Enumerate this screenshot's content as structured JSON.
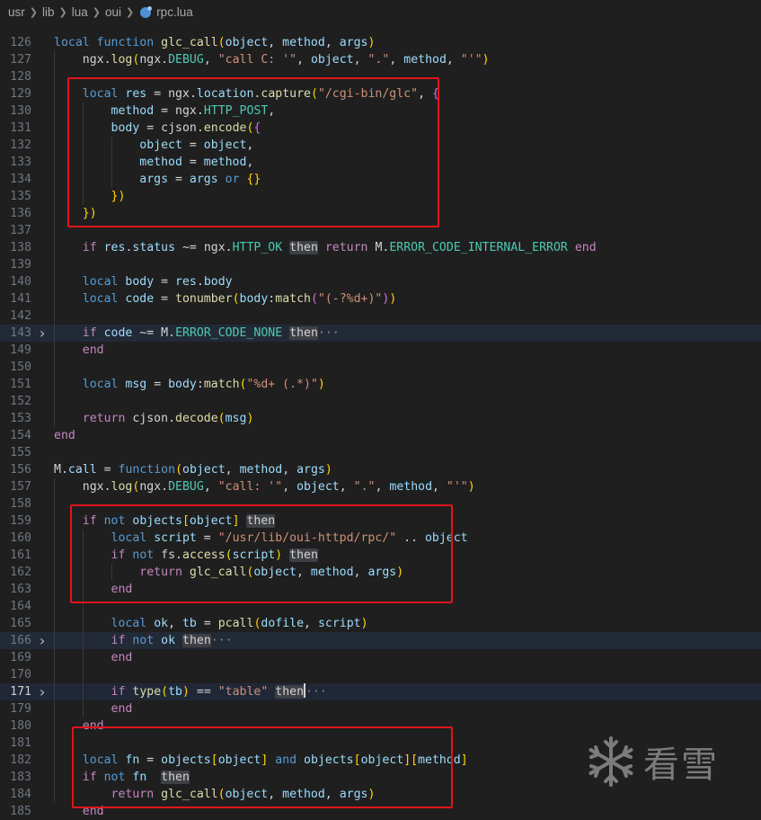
{
  "breadcrumb": {
    "segments": [
      "usr",
      "lib",
      "lua",
      "oui"
    ],
    "file": "rpc.lua",
    "file_icon": "lua-file-icon"
  },
  "editor": {
    "active_line": "171",
    "lines": [
      {
        "no": "126",
        "code": "local function glc_call(object, method, args)"
      },
      {
        "no": "127",
        "code": "    ngx.log(ngx.DEBUG, \"call C: '\", object, \".\", method, \"'\")"
      },
      {
        "no": "128",
        "code": ""
      },
      {
        "no": "129",
        "code": "    local res = ngx.location.capture(\"/cgi-bin/glc\", {"
      },
      {
        "no": "130",
        "code": "        method = ngx.HTTP_POST,"
      },
      {
        "no": "131",
        "code": "        body = cjson.encode({"
      },
      {
        "no": "132",
        "code": "            object = object,"
      },
      {
        "no": "133",
        "code": "            method = method,"
      },
      {
        "no": "134",
        "code": "            args = args or {}"
      },
      {
        "no": "135",
        "code": "        })"
      },
      {
        "no": "136",
        "code": "    })"
      },
      {
        "no": "137",
        "code": ""
      },
      {
        "no": "138",
        "code": "    if res.status ~= ngx.HTTP_OK then return M.ERROR_CODE_INTERNAL_ERROR end"
      },
      {
        "no": "139",
        "code": ""
      },
      {
        "no": "140",
        "code": "    local body = res.body"
      },
      {
        "no": "141",
        "code": "    local code = tonumber(body:match(\"(-?%d+)\"))"
      },
      {
        "no": "142",
        "code": ""
      },
      {
        "no": "143",
        "code": "    if code ~= M.ERROR_CODE_NONE then···",
        "folded": true
      },
      {
        "no": "149",
        "code": "    end"
      },
      {
        "no": "150",
        "code": ""
      },
      {
        "no": "151",
        "code": "    local msg = body:match(\"%d+ (.*)\")"
      },
      {
        "no": "152",
        "code": ""
      },
      {
        "no": "153",
        "code": "    return cjson.decode(msg)"
      },
      {
        "no": "154",
        "code": "end"
      },
      {
        "no": "155",
        "code": ""
      },
      {
        "no": "156",
        "code": "M.call = function(object, method, args)"
      },
      {
        "no": "157",
        "code": "    ngx.log(ngx.DEBUG, \"call: '\", object, \".\", method, \"'\")"
      },
      {
        "no": "158",
        "code": ""
      },
      {
        "no": "159",
        "code": "    if not objects[object] then"
      },
      {
        "no": "160",
        "code": "        local script = \"/usr/lib/oui-httpd/rpc/\" .. object"
      },
      {
        "no": "161",
        "code": "        if not fs.access(script) then"
      },
      {
        "no": "162",
        "code": "            return glc_call(object, method, args)"
      },
      {
        "no": "163",
        "code": "        end"
      },
      {
        "no": "164",
        "code": ""
      },
      {
        "no": "165",
        "code": "        local ok, tb = pcall(dofile, script)"
      },
      {
        "no": "166",
        "code": "        if not ok then···",
        "folded": true
      },
      {
        "no": "169",
        "code": "        end"
      },
      {
        "no": "170",
        "code": ""
      },
      {
        "no": "171",
        "code": "        if type(tb) == \"table\" then···",
        "folded": true,
        "current": true
      },
      {
        "no": "179",
        "code": "        end"
      },
      {
        "no": "180",
        "code": "    end"
      },
      {
        "no": "181",
        "code": ""
      },
      {
        "no": "182",
        "code": "    local fn = objects[object] and objects[object][method]"
      },
      {
        "no": "183",
        "code": "    if not fn  then"
      },
      {
        "no": "184",
        "code": "        return glc_call(object, method, args)"
      },
      {
        "no": "185",
        "code": "    end"
      }
    ]
  },
  "watermark": {
    "text": "看雪",
    "icon": "snowflake-logo-icon"
  },
  "colors": {
    "background": "#1f1f1f",
    "highlight_box": "#e1141b",
    "keyword": "#569cd6",
    "function": "#dcdcaa",
    "string": "#ce9178",
    "constant": "#4ec9b0"
  }
}
